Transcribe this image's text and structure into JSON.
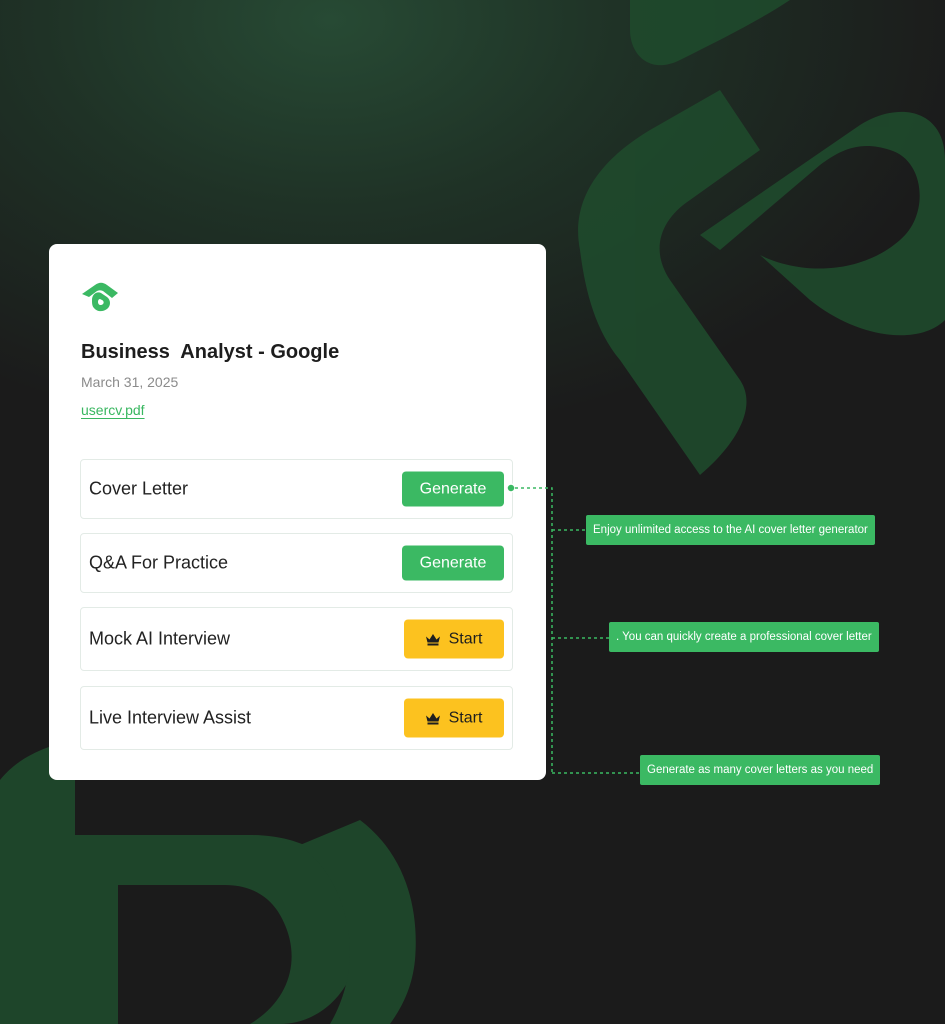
{
  "colors": {
    "background": "#1b1b1b",
    "brand_green": "#3bb963",
    "accent_yellow": "#fcc21f",
    "decor_green": "#1f4a2c"
  },
  "card": {
    "logo": "brand-logo-icon",
    "title": "Business  Analyst - Google",
    "date": "March 31, 2025",
    "file": "usercv.pdf"
  },
  "actions": [
    {
      "label": "Cover Letter",
      "button": "Generate",
      "button_style": "green"
    },
    {
      "label": "Q&A For Practice",
      "button": "Generate",
      "button_style": "green"
    },
    {
      "label": "Mock AI Interview",
      "button": "Start",
      "button_style": "yellow",
      "button_icon": "crown-icon"
    },
    {
      "label": "Live Interview Assist",
      "button": "Start",
      "button_style": "yellow",
      "button_icon": "crown-icon"
    }
  ],
  "callouts": [
    "Enjoy unlimited access to the AI cover letter generator",
    ". You can quickly create a professional cover letter",
    "Generate as many cover letters as you need"
  ]
}
